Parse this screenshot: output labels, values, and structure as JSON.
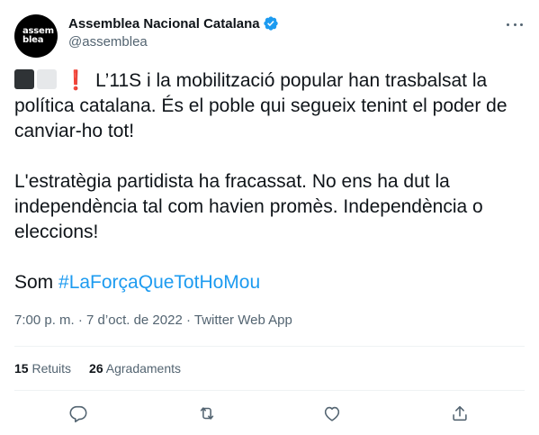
{
  "author": {
    "avatar_lines": [
      "assem",
      "blea"
    ],
    "name": "Assemblea Nacional Catalana",
    "handle": "@assemblea",
    "verified": true
  },
  "tweet": {
    "paragraph1": "L’11S i la mobilització popular han trasbalsat la política catalana. És el poble qui segueix tenint el poder de canviar-ho tot!",
    "paragraph2": "L'estratègia partidista ha fracassat. No ens ha dut la independència tal com havien promès. Independència o eleccions!",
    "paragraph3_prefix": "Som ",
    "hashtag": "#LaForçaQueTotHoMou",
    "leading_emoji": [
      "black-square-icon",
      "white-square-icon",
      "exclamation-icon"
    ],
    "exclamation": "❗"
  },
  "meta": {
    "time": "7:00 p. m.",
    "separator1": " · ",
    "date": "7 d’oct. de 2022",
    "separator2": " · ",
    "source": "Twitter Web App"
  },
  "stats": {
    "retweets_count": "15",
    "retweets_label": "Retuits",
    "likes_count": "26",
    "likes_label": "Agradaments"
  },
  "actions": [
    "reply-icon",
    "retweet-icon",
    "like-icon",
    "share-icon"
  ],
  "colors": {
    "accent": "#1d9bf0",
    "text": "#0f1419",
    "secondary": "#536471",
    "divider": "#eff3f4"
  }
}
